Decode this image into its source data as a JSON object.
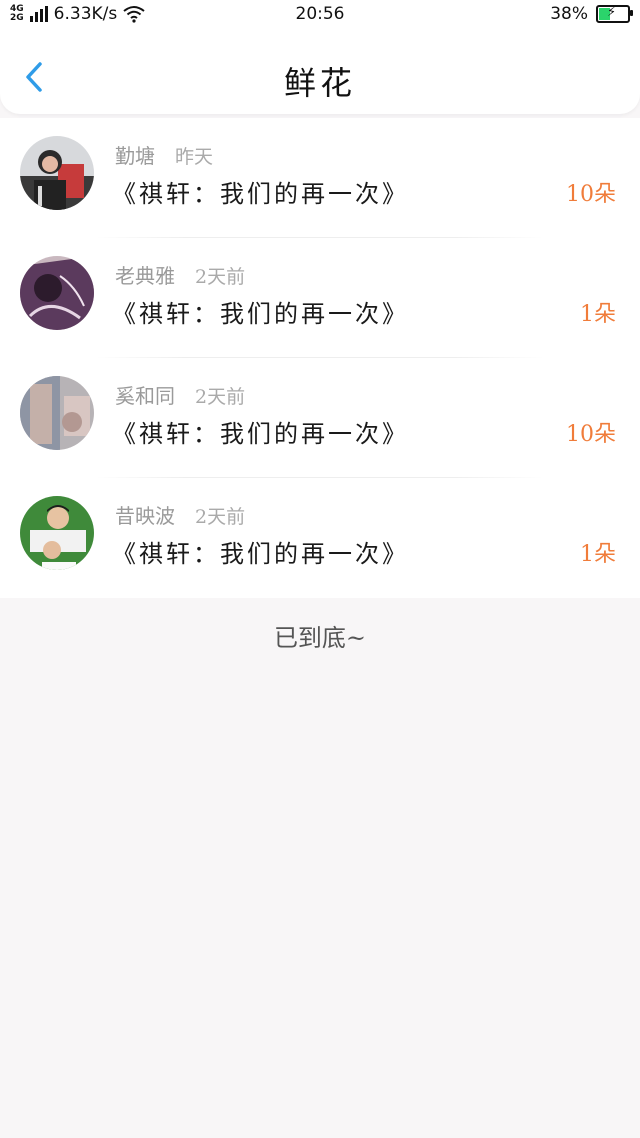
{
  "status_bar": {
    "network_top": "4G",
    "network_bottom": "2G",
    "speed": "6.33K/s",
    "time": "20:56",
    "battery_percent": "38%",
    "battery_level": 0.38,
    "wifi_icon": "wifi-icon"
  },
  "nav": {
    "title": "鲜花",
    "back_icon": "chevron-left-icon"
  },
  "items": [
    {
      "name": "勤塘",
      "time": "昨天",
      "title": "《祺轩：我们的再一次》",
      "count": "10朵"
    },
    {
      "name": "老典雅",
      "time": "2天前",
      "title": "《祺轩：我们的再一次》",
      "count": "1朵"
    },
    {
      "name": "奚和同",
      "time": "2天前",
      "title": "《祺轩：我们的再一次》",
      "count": "10朵"
    },
    {
      "name": "昔映波",
      "time": "2天前",
      "title": "《祺轩：我们的再一次》",
      "count": "1朵"
    }
  ],
  "footer": {
    "end_text": "已到底~"
  },
  "colors": {
    "accent": "#2f9ce8",
    "count": "#f07c3a"
  }
}
